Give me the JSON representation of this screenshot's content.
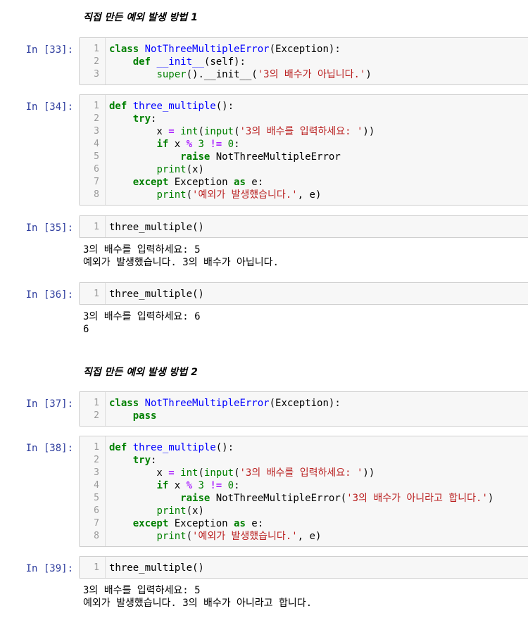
{
  "headings": {
    "h1": "직접 만든 예외 발생 방법 1",
    "h2": "직접 만든 예외 발생 방법 2"
  },
  "cells": [
    {
      "prompt": "In [33]:",
      "lines": [
        [
          {
            "t": "class",
            "c": "kw"
          },
          {
            "t": " "
          },
          {
            "t": "NotThreeMultipleError",
            "c": "def"
          },
          {
            "t": "(Exception):"
          }
        ],
        [
          {
            "t": "    "
          },
          {
            "t": "def",
            "c": "kw"
          },
          {
            "t": " "
          },
          {
            "t": "__init__",
            "c": "def"
          },
          {
            "t": "(self):"
          }
        ],
        [
          {
            "t": "        "
          },
          {
            "t": "super",
            "c": "bi"
          },
          {
            "t": "().__init__("
          },
          {
            "t": "'3의 배수가 아닙니다.'",
            "c": "str"
          },
          {
            "t": ")"
          }
        ]
      ]
    },
    {
      "prompt": "In [34]:",
      "lines": [
        [
          {
            "t": "def",
            "c": "kw"
          },
          {
            "t": " "
          },
          {
            "t": "three_multiple",
            "c": "def"
          },
          {
            "t": "():"
          }
        ],
        [
          {
            "t": "    "
          },
          {
            "t": "try",
            "c": "kw"
          },
          {
            "t": ":"
          }
        ],
        [
          {
            "t": "        x "
          },
          {
            "t": "=",
            "c": "op"
          },
          {
            "t": " "
          },
          {
            "t": "int",
            "c": "bi"
          },
          {
            "t": "("
          },
          {
            "t": "input",
            "c": "bi"
          },
          {
            "t": "("
          },
          {
            "t": "'3의 배수를 입력하세요: '",
            "c": "str"
          },
          {
            "t": "))"
          }
        ],
        [
          {
            "t": "        "
          },
          {
            "t": "if",
            "c": "kw"
          },
          {
            "t": " x "
          },
          {
            "t": "%",
            "c": "op"
          },
          {
            "t": " "
          },
          {
            "t": "3",
            "c": "num"
          },
          {
            "t": " "
          },
          {
            "t": "!=",
            "c": "op"
          },
          {
            "t": " "
          },
          {
            "t": "0",
            "c": "num"
          },
          {
            "t": ":"
          }
        ],
        [
          {
            "t": "            "
          },
          {
            "t": "raise",
            "c": "kw"
          },
          {
            "t": " NotThreeMultipleError"
          }
        ],
        [
          {
            "t": "        "
          },
          {
            "t": "print",
            "c": "bi"
          },
          {
            "t": "(x)"
          }
        ],
        [
          {
            "t": "    "
          },
          {
            "t": "except",
            "c": "kw"
          },
          {
            "t": " Exception "
          },
          {
            "t": "as",
            "c": "kw"
          },
          {
            "t": " e:"
          }
        ],
        [
          {
            "t": "        "
          },
          {
            "t": "print",
            "c": "bi"
          },
          {
            "t": "("
          },
          {
            "t": "'예외가 발생했습니다.'",
            "c": "str"
          },
          {
            "t": ", e)"
          }
        ]
      ]
    },
    {
      "prompt": "In [35]:",
      "lines": [
        [
          {
            "t": "three_multiple()"
          }
        ]
      ],
      "output": [
        "3의 배수를 입력하세요: 5",
        "예외가 발생했습니다. 3의 배수가 아닙니다."
      ]
    },
    {
      "prompt": "In [36]:",
      "lines": [
        [
          {
            "t": "three_multiple()"
          }
        ]
      ],
      "output": [
        "3의 배수를 입력하세요: 6",
        "6"
      ]
    },
    {
      "prompt": "In [37]:",
      "lines": [
        [
          {
            "t": "class",
            "c": "kw"
          },
          {
            "t": " "
          },
          {
            "t": "NotThreeMultipleError",
            "c": "def"
          },
          {
            "t": "(Exception):"
          }
        ],
        [
          {
            "t": "    "
          },
          {
            "t": "pass",
            "c": "kw"
          }
        ]
      ]
    },
    {
      "prompt": "In [38]:",
      "lines": [
        [
          {
            "t": "def",
            "c": "kw"
          },
          {
            "t": " "
          },
          {
            "t": "three_multiple",
            "c": "def"
          },
          {
            "t": "():"
          }
        ],
        [
          {
            "t": "    "
          },
          {
            "t": "try",
            "c": "kw"
          },
          {
            "t": ":"
          }
        ],
        [
          {
            "t": "        x "
          },
          {
            "t": "=",
            "c": "op"
          },
          {
            "t": " "
          },
          {
            "t": "int",
            "c": "bi"
          },
          {
            "t": "("
          },
          {
            "t": "input",
            "c": "bi"
          },
          {
            "t": "("
          },
          {
            "t": "'3의 배수를 입력하세요: '",
            "c": "str"
          },
          {
            "t": "))"
          }
        ],
        [
          {
            "t": "        "
          },
          {
            "t": "if",
            "c": "kw"
          },
          {
            "t": " x "
          },
          {
            "t": "%",
            "c": "op"
          },
          {
            "t": " "
          },
          {
            "t": "3",
            "c": "num"
          },
          {
            "t": " "
          },
          {
            "t": "!=",
            "c": "op"
          },
          {
            "t": " "
          },
          {
            "t": "0",
            "c": "num"
          },
          {
            "t": ":"
          }
        ],
        [
          {
            "t": "            "
          },
          {
            "t": "raise",
            "c": "kw"
          },
          {
            "t": " NotThreeMultipleError("
          },
          {
            "t": "'3의 배수가 아니라고 합니다.'",
            "c": "str"
          },
          {
            "t": ")"
          }
        ],
        [
          {
            "t": "        "
          },
          {
            "t": "print",
            "c": "bi"
          },
          {
            "t": "(x)"
          }
        ],
        [
          {
            "t": "    "
          },
          {
            "t": "except",
            "c": "kw"
          },
          {
            "t": " Exception "
          },
          {
            "t": "as",
            "c": "kw"
          },
          {
            "t": " e:"
          }
        ],
        [
          {
            "t": "        "
          },
          {
            "t": "print",
            "c": "bi"
          },
          {
            "t": "("
          },
          {
            "t": "'예외가 발생했습니다.'",
            "c": "str"
          },
          {
            "t": ", e)"
          }
        ]
      ]
    },
    {
      "prompt": "In [39]:",
      "lines": [
        [
          {
            "t": "three_multiple()"
          }
        ]
      ],
      "output": [
        "3의 배수를 입력하세요: 5",
        "예외가 발생했습니다. 3의 배수가 아니라고 합니다."
      ]
    }
  ]
}
